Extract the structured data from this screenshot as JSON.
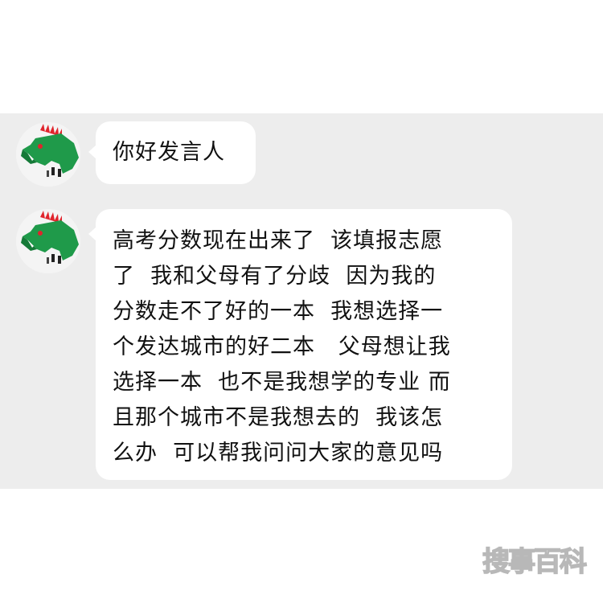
{
  "conversation": {
    "messages": [
      {
        "lines": [
          "你好发言人"
        ]
      },
      {
        "lines": [
          "高考分数现在出来了  该填报志愿",
          "了  我和父母有了分歧  因为我的",
          "分数走不了好的一本  我想选择一",
          "个发达城市的好二本   父母想让我",
          "选择一本  也不是我想学的专业 而",
          "且那个城市不是我想去的  我该怎",
          "么办  可以帮我问问大家的意见吗"
        ]
      }
    ]
  },
  "watermark": {
    "text": "搜事百科"
  },
  "colors": {
    "chat_background": "#ededed",
    "bubble": "#ffffff",
    "avatar_dino": "#1f9a4a",
    "avatar_spikes": "#e0242c"
  }
}
